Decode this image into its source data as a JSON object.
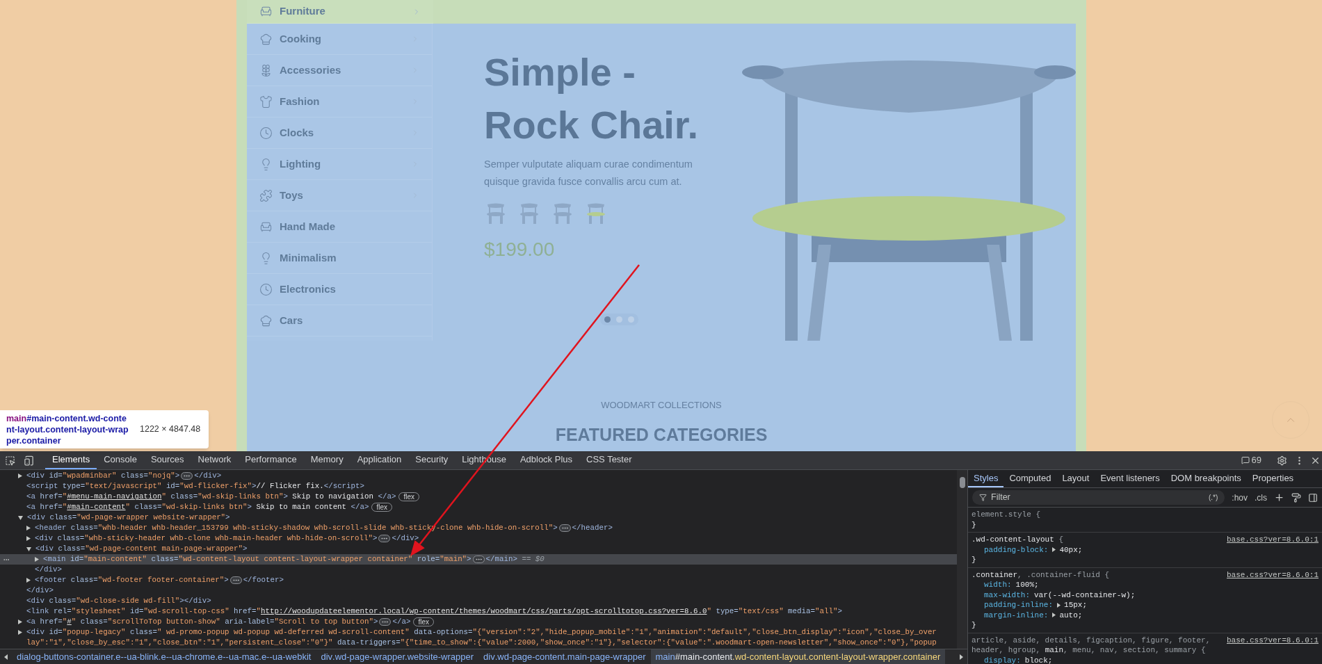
{
  "storefront": {
    "categories": [
      {
        "label": "Furniture",
        "has_submenu": true
      },
      {
        "label": "Cooking",
        "has_submenu": true
      },
      {
        "label": "Accessories",
        "has_submenu": true
      },
      {
        "label": "Fashion",
        "has_submenu": true
      },
      {
        "label": "Clocks",
        "has_submenu": true
      },
      {
        "label": "Lighting",
        "has_submenu": true
      },
      {
        "label": "Toys",
        "has_submenu": true
      },
      {
        "label": "Hand Made",
        "has_submenu": false
      },
      {
        "label": "Minimalism",
        "has_submenu": false
      },
      {
        "label": "Electronics",
        "has_submenu": false
      },
      {
        "label": "Cars",
        "has_submenu": false
      }
    ],
    "hero": {
      "title_lines": [
        "Simple -",
        "Rock Chair."
      ],
      "description": "Semper vulputate aliquam curae condimentum quisque gravida fusce convallis arcu cum at.",
      "price": "$199.00",
      "slider_dots": [
        {
          "selected": true
        },
        {
          "selected": false
        },
        {
          "selected": false
        }
      ]
    },
    "section": {
      "subtitle": "WOODMART COLLECTIONS",
      "title": "FEATURED CATEGORIES"
    }
  },
  "inspect_tooltip": {
    "tag": "main",
    "selector": "#main-content.wd-content-layout.content-layout-wrapper.container",
    "size": "1222 × 4847.48"
  },
  "devtools": {
    "tabs": [
      {
        "label": "Elements",
        "selected": true
      },
      {
        "label": "Console",
        "selected": false
      },
      {
        "label": "Sources",
        "selected": false
      },
      {
        "label": "Network",
        "selected": false
      },
      {
        "label": "Performance",
        "selected": false
      },
      {
        "label": "Memory",
        "selected": false
      },
      {
        "label": "Application",
        "selected": false
      },
      {
        "label": "Security",
        "selected": false
      },
      {
        "label": "Lighthouse",
        "selected": false
      },
      {
        "label": "Adblock Plus",
        "selected": false
      },
      {
        "label": "CSS Tester",
        "selected": false
      }
    ],
    "issues_count": "69",
    "elements": {
      "nodes": [
        {
          "expanded": false,
          "selected": false,
          "tokens": [
            {
              "kind": "tag",
              "text": "<div"
            },
            {
              "kind": "attr",
              "text": " id="
            },
            {
              "kind": "val",
              "text": "\"wpadminbar\""
            },
            {
              "kind": "attr",
              "text": " class="
            },
            {
              "kind": "val",
              "text": "\"nojq\""
            },
            {
              "kind": "tag",
              "text": ">"
            },
            {
              "kind": "ellipsis"
            },
            {
              "kind": "tag",
              "text": "</div>"
            }
          ]
        },
        {
          "selected": false,
          "tokens": [
            {
              "kind": "tag",
              "text": "<script"
            },
            {
              "kind": "attr",
              "text": " type="
            },
            {
              "kind": "val",
              "text": "\"text/javascript\""
            },
            {
              "kind": "attr",
              "text": " id="
            },
            {
              "kind": "val",
              "text": "\"wd-flicker-fix\""
            },
            {
              "kind": "tag",
              "text": ">"
            },
            {
              "kind": "text",
              "text": "// Flicker fix."
            },
            {
              "kind": "tag",
              "text": "</script>"
            }
          ]
        },
        {
          "selected": false,
          "tokens": [
            {
              "kind": "tag",
              "text": "<a"
            },
            {
              "kind": "attr",
              "text": " href="
            },
            {
              "kind": "val",
              "text": "\""
            },
            {
              "kind": "link",
              "text": "#menu-main-navigation"
            },
            {
              "kind": "val",
              "text": "\""
            },
            {
              "kind": "attr",
              "text": " class="
            },
            {
              "kind": "val",
              "text": "\"wd-skip-links btn\""
            },
            {
              "kind": "tag",
              "text": ">"
            },
            {
              "kind": "text",
              "text": " Skip to navigation "
            },
            {
              "kind": "tag",
              "text": "</a>"
            },
            {
              "kind": "badge",
              "text": "flex"
            }
          ]
        },
        {
          "selected": false,
          "tokens": [
            {
              "kind": "tag",
              "text": "<a"
            },
            {
              "kind": "attr",
              "text": " href="
            },
            {
              "kind": "val",
              "text": "\""
            },
            {
              "kind": "link",
              "text": "#main-content"
            },
            {
              "kind": "val",
              "text": "\""
            },
            {
              "kind": "attr",
              "text": " class="
            },
            {
              "kind": "val",
              "text": "\"wd-skip-links btn\""
            },
            {
              "kind": "tag",
              "text": ">"
            },
            {
              "kind": "text",
              "text": " Skip to main content "
            },
            {
              "kind": "tag",
              "text": "</a>"
            },
            {
              "kind": "badge",
              "text": "flex"
            }
          ]
        },
        {
          "expanded": true,
          "selected": false,
          "tokens": [
            {
              "kind": "tag",
              "text": "<div"
            },
            {
              "kind": "attr",
              "text": " class="
            },
            {
              "kind": "val",
              "text": "\"wd-page-wrapper website-wrapper\""
            },
            {
              "kind": "tag",
              "text": ">"
            }
          ],
          "closing": [
            {
              "kind": "tag",
              "text": "</div>"
            }
          ],
          "children": [
            {
              "expanded": false,
              "selected": false,
              "tokens": [
                {
                  "kind": "tag",
                  "text": "<header"
                },
                {
                  "kind": "attr",
                  "text": " class="
                },
                {
                  "kind": "val",
                  "text": "\"whb-header whb-header_153799 whb-sticky-shadow whb-scroll-slide whb-sticky-clone whb-hide-on-scroll\""
                },
                {
                  "kind": "tag",
                  "text": ">"
                },
                {
                  "kind": "ellipsis"
                },
                {
                  "kind": "tag",
                  "text": "</header>"
                }
              ]
            },
            {
              "expanded": false,
              "selected": false,
              "tokens": [
                {
                  "kind": "tag",
                  "text": "<div"
                },
                {
                  "kind": "attr",
                  "text": " class="
                },
                {
                  "kind": "val",
                  "text": "\"whb-sticky-header whb-clone whb-main-header whb-hide-on-scroll\""
                },
                {
                  "kind": "tag",
                  "text": ">"
                },
                {
                  "kind": "ellipsis"
                },
                {
                  "kind": "tag",
                  "text": "</div>"
                }
              ]
            },
            {
              "expanded": true,
              "selected": false,
              "tokens": [
                {
                  "kind": "tag",
                  "text": "<div"
                },
                {
                  "kind": "attr",
                  "text": " class="
                },
                {
                  "kind": "val",
                  "text": "\"wd-page-content main-page-wrapper\""
                },
                {
                  "kind": "tag",
                  "text": ">"
                }
              ],
              "closing": [
                {
                  "kind": "tag",
                  "text": "</div>"
                }
              ],
              "children": [
                {
                  "expanded": false,
                  "selected": true,
                  "tokens": [
                    {
                      "kind": "tag",
                      "text": "<main"
                    },
                    {
                      "kind": "attr",
                      "text": " id="
                    },
                    {
                      "kind": "val",
                      "text": "\"main-content\""
                    },
                    {
                      "kind": "attr",
                      "text": " class="
                    },
                    {
                      "kind": "val",
                      "text": "\"wd-content-layout content-layout-wrapper container\""
                    },
                    {
                      "kind": "attr",
                      "text": " role="
                    },
                    {
                      "kind": "val",
                      "text": "\"main\""
                    },
                    {
                      "kind": "tag",
                      "text": ">"
                    },
                    {
                      "kind": "ellipsis"
                    },
                    {
                      "kind": "tag",
                      "text": "</main>"
                    },
                    {
                      "kind": "dollar",
                      "text": " == $0"
                    }
                  ]
                }
              ]
            },
            {
              "expanded": false,
              "selected": false,
              "tokens": [
                {
                  "kind": "tag",
                  "text": "<footer"
                },
                {
                  "kind": "attr",
                  "text": " class="
                },
                {
                  "kind": "val",
                  "text": "\"wd-footer footer-container\""
                },
                {
                  "kind": "tag",
                  "text": ">"
                },
                {
                  "kind": "ellipsis"
                },
                {
                  "kind": "tag",
                  "text": "</footer>"
                }
              ]
            }
          ]
        },
        {
          "selected": false,
          "tokens": [
            {
              "kind": "tag",
              "text": "<div"
            },
            {
              "kind": "attr",
              "text": " class="
            },
            {
              "kind": "val",
              "text": "\"wd-close-side wd-fill\""
            },
            {
              "kind": "tag",
              "text": "></div>"
            }
          ]
        },
        {
          "selected": false,
          "tokens": [
            {
              "kind": "tag",
              "text": "<link"
            },
            {
              "kind": "attr",
              "text": " rel="
            },
            {
              "kind": "val",
              "text": "\"stylesheet\""
            },
            {
              "kind": "attr",
              "text": " id="
            },
            {
              "kind": "val",
              "text": "\"wd-scroll-top-css\""
            },
            {
              "kind": "attr",
              "text": " href="
            },
            {
              "kind": "val",
              "text": "\""
            },
            {
              "kind": "link",
              "text": "http://woodupdateelementor.local/wp-content/themes/woodmart/css/parts/opt-scrolltotop.css?ver=8.6.0"
            },
            {
              "kind": "val",
              "text": "\""
            },
            {
              "kind": "attr",
              "text": " type="
            },
            {
              "kind": "val",
              "text": "\"text/css\""
            },
            {
              "kind": "attr",
              "text": " media="
            },
            {
              "kind": "val",
              "text": "\"all\""
            },
            {
              "kind": "tag",
              "text": ">"
            }
          ]
        },
        {
          "expanded": false,
          "selected": false,
          "tokens": [
            {
              "kind": "tag",
              "text": "<a"
            },
            {
              "kind": "attr",
              "text": " href="
            },
            {
              "kind": "val",
              "text": "\""
            },
            {
              "kind": "link",
              "text": "#"
            },
            {
              "kind": "val",
              "text": "\""
            },
            {
              "kind": "attr",
              "text": " class="
            },
            {
              "kind": "val",
              "text": "\"scrollToTop button-show\""
            },
            {
              "kind": "attr",
              "text": " aria-label="
            },
            {
              "kind": "val",
              "text": "\"Scroll to top button\""
            },
            {
              "kind": "tag",
              "text": ">"
            },
            {
              "kind": "ellipsis"
            },
            {
              "kind": "tag",
              "text": "</a>"
            },
            {
              "kind": "badge",
              "text": "flex"
            }
          ]
        },
        {
          "expanded": false,
          "selected": false,
          "tokens": [
            {
              "kind": "tag",
              "text": "<div"
            },
            {
              "kind": "attr",
              "text": " id="
            },
            {
              "kind": "val",
              "text": "\"popup-legacy\""
            },
            {
              "kind": "attr",
              "text": " class="
            },
            {
              "kind": "val",
              "text": "\" wd-promo-popup wd-popup wd-deferred wd-scroll-content\""
            },
            {
              "kind": "attr",
              "text": " data-options="
            },
            {
              "kind": "val",
              "text": "\"{\"version\":\"2\",\"hide_popup_mobile\":\"1\",\"animation\":\"default\",\"close_btn_display\":\"icon\",\"close_by_over"
            }
          ],
          "wrap": [
            {
              "kind": "val",
              "text": "lay\":\"1\",\"close_by_esc\":\"1\",\"close_btn\":\"1\",\"persistent_close\":\"0\"}\""
            },
            {
              "kind": "attr",
              "text": " data-triggers="
            },
            {
              "kind": "val",
              "text": "\"{\"time_to_show\":{\"value\":2000,\"show_once\":\"1\"},\"selector\":{\"value\":\".woodmart-open-newsletter\",\"show_once\":\"0\"},\"popup"
            }
          ]
        }
      ]
    },
    "breadcrumbs": [
      {
        "classes": "dialog-buttons-container.e--ua-blink.e--ua-chrome.e--ua-mac.e--ua-webkit",
        "selected": false
      },
      {
        "tag": "div",
        "classes": ".wd-page-wrapper.website-wrapper",
        "selected": false
      },
      {
        "tag": "div",
        "classes": ".wd-page-content.main-page-wrapper",
        "selected": false
      },
      {
        "tag": "main",
        "id": "#main-content",
        "classes": ".wd-content-layout.content-layout-wrapper.container",
        "selected": true
      }
    ],
    "styles": {
      "tabs": [
        {
          "label": "Styles",
          "selected": true
        },
        {
          "label": "Computed",
          "selected": false
        },
        {
          "label": "Layout",
          "selected": false
        },
        {
          "label": "Event listeners",
          "selected": false
        },
        {
          "label": "DOM breakpoints",
          "selected": false
        },
        {
          "label": "Properties",
          "selected": false
        }
      ],
      "filter_placeholder": "Filter",
      "regex_toggle": "(.*)",
      "hov": ":hov",
      "cls": ".cls",
      "rules": [
        {
          "selectors": [
            {
              "text": "element.style",
              "matched": false
            },
            {
              "text": " {",
              "matched": false
            }
          ],
          "close": "}"
        },
        {
          "selectors": [
            {
              "text": ".wd-content-layout",
              "matched": true
            },
            {
              "text": " {",
              "matched": false
            }
          ],
          "source": "base.css?ver=8.6.0:1",
          "close": "}",
          "props": [
            {
              "name": "padding-block:",
              "value": "40px;",
              "expandable": true
            }
          ]
        },
        {
          "selectors": [
            {
              "text": ".container",
              "matched": true
            },
            {
              "text": ", .container-fluid {",
              "matched": false
            }
          ],
          "source": "base.css?ver=8.6.0:1",
          "close": "}",
          "props": [
            {
              "name": "width:",
              "value": "100%;",
              "expandable": false
            },
            {
              "name": "max-width:",
              "value": "var(--wd-container-w);",
              "expandable": false
            },
            {
              "name": "padding-inline:",
              "value": "15px;",
              "expandable": true
            },
            {
              "name": "margin-inline:",
              "value": "auto;",
              "expandable": true
            }
          ]
        },
        {
          "selectors": [
            {
              "text": "article, aside, details, figcaption, figure, footer, header, hgroup, ",
              "matched": false
            },
            {
              "text": "main",
              "matched": true
            },
            {
              "text": ", menu, nav, section, summary {",
              "matched": false
            }
          ],
          "source": "base.css?ver=8.6.0:1",
          "props": [
            {
              "name": "display:",
              "value": "block;",
              "expandable": false
            }
          ]
        }
      ]
    }
  }
}
